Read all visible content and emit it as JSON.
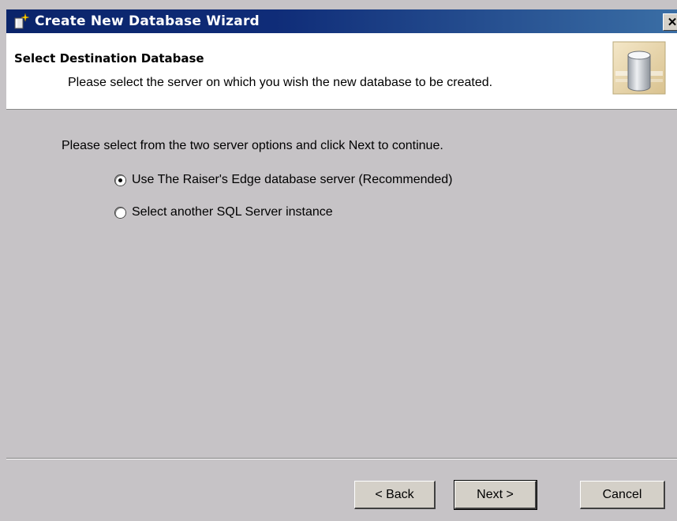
{
  "window": {
    "title": "Create New Database Wizard",
    "close_label": "✕"
  },
  "header": {
    "title": "Select Destination Database",
    "subtitle": "Please select the server on which you wish the new database to be created."
  },
  "content": {
    "instructions": "Please select from the two server options and click Next to continue.",
    "options": [
      {
        "label": "Use The Raiser's Edge database server (Recommended)",
        "selected": true
      },
      {
        "label": "Select another SQL Server instance",
        "selected": false
      }
    ]
  },
  "footer": {
    "back_label": "< Back",
    "next_label": "Next >",
    "cancel_label": "Cancel"
  }
}
